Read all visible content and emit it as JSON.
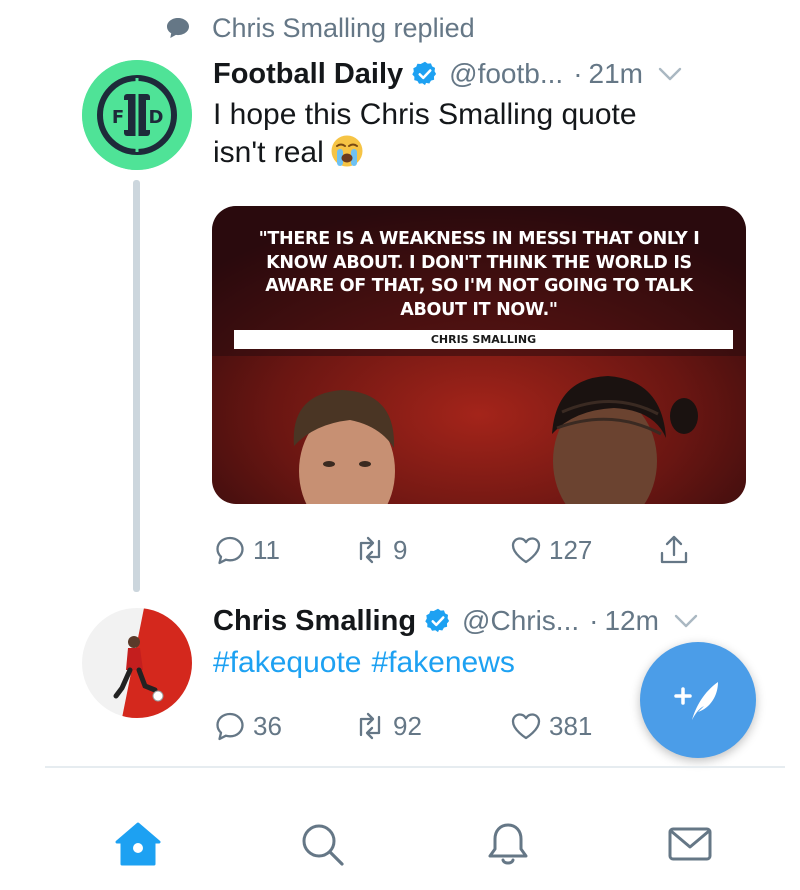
{
  "social_context": {
    "text": "Chris Smalling replied",
    "icon": "reply-bubble-icon"
  },
  "tweets": [
    {
      "author": {
        "name": "Football Daily",
        "handle": "@footb...",
        "verified": true,
        "avatar_text": "F D"
      },
      "time": "21m",
      "text_line1": "I hope this Chris Smalling quote",
      "text_line2": "isn't real",
      "emoji": "loudly-crying-face-emoji",
      "media": {
        "quote_line1": "\"THERE IS A WEAKNESS IN MESSI THAT ONLY I",
        "quote_line2": "KNOW ABOUT. I DON'T THINK THE WORLD IS",
        "quote_line3": "AWARE OF THAT, SO I'M NOT GOING TO TALK",
        "quote_line4": "ABOUT IT NOW.\"",
        "attribution": "CHRIS SMALLING"
      },
      "stats": {
        "replies": "11",
        "retweets": "9",
        "likes": "127"
      }
    },
    {
      "author": {
        "name": "Chris Smalling",
        "handle": "@Chris...",
        "verified": true
      },
      "time": "12m",
      "hashtags": [
        "#fakequote",
        "#fakenews"
      ],
      "stats": {
        "replies": "36",
        "retweets": "92",
        "likes": "381"
      }
    }
  ],
  "compose_button": {
    "icon": "compose-tweet-icon"
  },
  "tab_bar": {
    "items": [
      {
        "name": "home",
        "icon": "home-icon",
        "active": true
      },
      {
        "name": "search",
        "icon": "search-icon",
        "active": false
      },
      {
        "name": "notifications",
        "icon": "bell-icon",
        "active": false
      },
      {
        "name": "messages",
        "icon": "envelope-icon",
        "active": false
      }
    ]
  },
  "colors": {
    "accent": "#1da1f2",
    "secondary_text": "#657786",
    "fd_green": "#4fe397",
    "fab_blue": "#4b9de8"
  }
}
